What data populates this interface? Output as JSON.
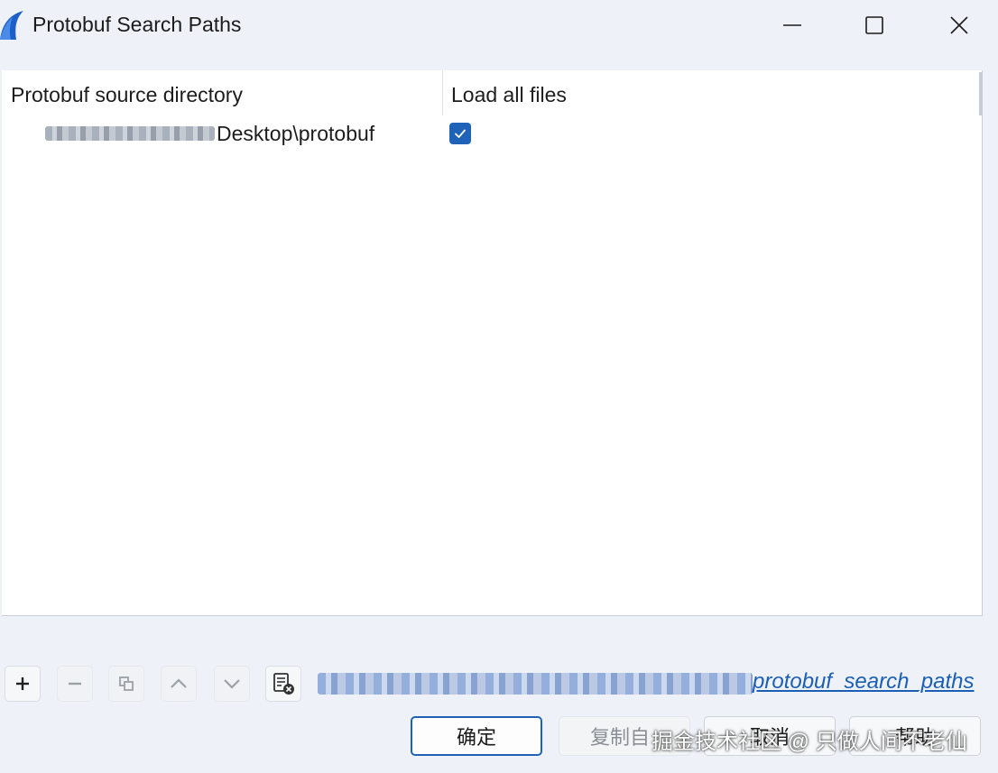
{
  "window": {
    "title": "Protobuf Search Paths",
    "icon": "wireshark-fin-icon",
    "controls": [
      "minimize-icon",
      "maximize-icon",
      "close-icon"
    ]
  },
  "table": {
    "columns": [
      "Protobuf source directory",
      "Load all files"
    ],
    "rows": [
      {
        "directory_visible": "Desktop\\protobuf",
        "load_all_files": true
      }
    ]
  },
  "toolbar": {
    "buttons": [
      "add-icon",
      "remove-icon",
      "copy-icon",
      "move-up-icon",
      "move-down-icon",
      "clear-list-icon"
    ],
    "path_link_visible": "protobuf_search_paths"
  },
  "buttons": {
    "ok": "确定",
    "copy": "复制自",
    "cancel": "取消",
    "help": "帮助"
  },
  "watermark": "掘金技术社区 @ 只做人间不老仙",
  "colors": {
    "accent": "#1e63b8",
    "link": "#1a5fb4",
    "background": "#eef2f8"
  }
}
